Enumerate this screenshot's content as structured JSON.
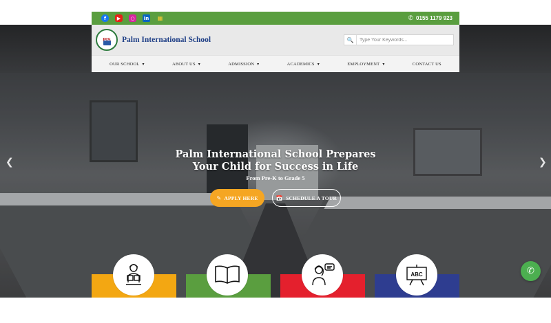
{
  "topbar": {
    "phone": "0155 1179 923",
    "social_icons": [
      "facebook-icon",
      "youtube-icon",
      "instagram-icon",
      "linkedin-icon",
      "microsoft-icon"
    ]
  },
  "brand": {
    "logo_text": "PIS",
    "name": "Palm International School"
  },
  "search": {
    "placeholder": "Type Your Keywords..."
  },
  "nav": {
    "items": [
      {
        "label": "OUR SCHOOL",
        "dropdown": true
      },
      {
        "label": "ABOUT US",
        "dropdown": true
      },
      {
        "label": "ADMISSION",
        "dropdown": true
      },
      {
        "label": "ACADEMICS",
        "dropdown": true
      },
      {
        "label": "EMPLOYMENT",
        "dropdown": true
      },
      {
        "label": "CONTACT US",
        "dropdown": false
      }
    ]
  },
  "hero": {
    "title_line1": "Palm International School Prepares",
    "title_line2": "Your Child for Success in Life",
    "subtitle": "From Pre-K to Grade 5",
    "apply_label": "APPLY HERE",
    "tour_label": "SCHEDULE A TOUR"
  },
  "features": {
    "card_colors": [
      "#f3a712",
      "#5a9e3f",
      "#e4202d",
      "#2e3d90"
    ],
    "icons": [
      "reading-student-icon",
      "open-book-icon",
      "teacher-icon",
      "abc-board-icon"
    ],
    "abc_text": "ABC"
  },
  "colors": {
    "accent_green": "#5a9e3f",
    "brand_blue": "#1f3f86",
    "apply_orange": "#f5a623"
  }
}
